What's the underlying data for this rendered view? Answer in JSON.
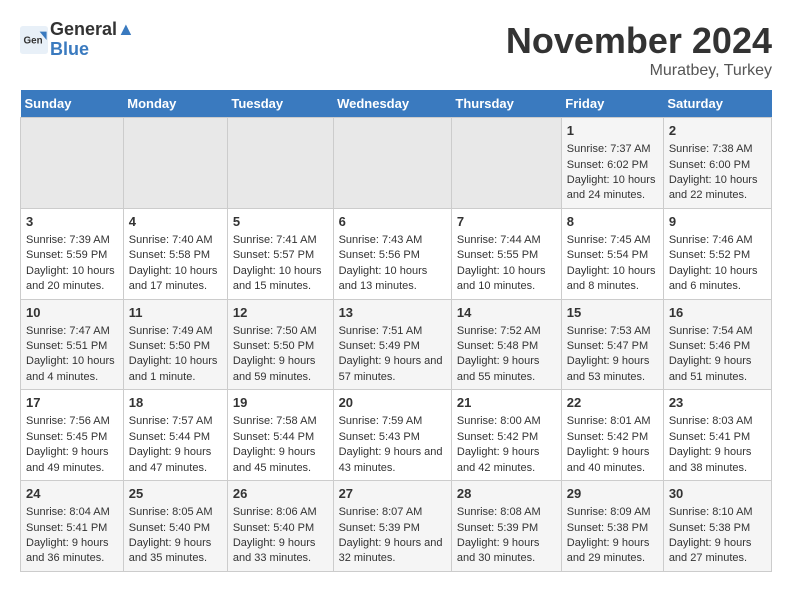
{
  "header": {
    "logo_line1": "General",
    "logo_line2": "Blue",
    "month": "November 2024",
    "location": "Muratbey, Turkey"
  },
  "days_of_week": [
    "Sunday",
    "Monday",
    "Tuesday",
    "Wednesday",
    "Thursday",
    "Friday",
    "Saturday"
  ],
  "weeks": [
    [
      {
        "day": "",
        "info": ""
      },
      {
        "day": "",
        "info": ""
      },
      {
        "day": "",
        "info": ""
      },
      {
        "day": "",
        "info": ""
      },
      {
        "day": "",
        "info": ""
      },
      {
        "day": "1",
        "info": "Sunrise: 7:37 AM\nSunset: 6:02 PM\nDaylight: 10 hours and 24 minutes."
      },
      {
        "day": "2",
        "info": "Sunrise: 7:38 AM\nSunset: 6:00 PM\nDaylight: 10 hours and 22 minutes."
      }
    ],
    [
      {
        "day": "3",
        "info": "Sunrise: 7:39 AM\nSunset: 5:59 PM\nDaylight: 10 hours and 20 minutes."
      },
      {
        "day": "4",
        "info": "Sunrise: 7:40 AM\nSunset: 5:58 PM\nDaylight: 10 hours and 17 minutes."
      },
      {
        "day": "5",
        "info": "Sunrise: 7:41 AM\nSunset: 5:57 PM\nDaylight: 10 hours and 15 minutes."
      },
      {
        "day": "6",
        "info": "Sunrise: 7:43 AM\nSunset: 5:56 PM\nDaylight: 10 hours and 13 minutes."
      },
      {
        "day": "7",
        "info": "Sunrise: 7:44 AM\nSunset: 5:55 PM\nDaylight: 10 hours and 10 minutes."
      },
      {
        "day": "8",
        "info": "Sunrise: 7:45 AM\nSunset: 5:54 PM\nDaylight: 10 hours and 8 minutes."
      },
      {
        "day": "9",
        "info": "Sunrise: 7:46 AM\nSunset: 5:52 PM\nDaylight: 10 hours and 6 minutes."
      }
    ],
    [
      {
        "day": "10",
        "info": "Sunrise: 7:47 AM\nSunset: 5:51 PM\nDaylight: 10 hours and 4 minutes."
      },
      {
        "day": "11",
        "info": "Sunrise: 7:49 AM\nSunset: 5:50 PM\nDaylight: 10 hours and 1 minute."
      },
      {
        "day": "12",
        "info": "Sunrise: 7:50 AM\nSunset: 5:50 PM\nDaylight: 9 hours and 59 minutes."
      },
      {
        "day": "13",
        "info": "Sunrise: 7:51 AM\nSunset: 5:49 PM\nDaylight: 9 hours and 57 minutes."
      },
      {
        "day": "14",
        "info": "Sunrise: 7:52 AM\nSunset: 5:48 PM\nDaylight: 9 hours and 55 minutes."
      },
      {
        "day": "15",
        "info": "Sunrise: 7:53 AM\nSunset: 5:47 PM\nDaylight: 9 hours and 53 minutes."
      },
      {
        "day": "16",
        "info": "Sunrise: 7:54 AM\nSunset: 5:46 PM\nDaylight: 9 hours and 51 minutes."
      }
    ],
    [
      {
        "day": "17",
        "info": "Sunrise: 7:56 AM\nSunset: 5:45 PM\nDaylight: 9 hours and 49 minutes."
      },
      {
        "day": "18",
        "info": "Sunrise: 7:57 AM\nSunset: 5:44 PM\nDaylight: 9 hours and 47 minutes."
      },
      {
        "day": "19",
        "info": "Sunrise: 7:58 AM\nSunset: 5:44 PM\nDaylight: 9 hours and 45 minutes."
      },
      {
        "day": "20",
        "info": "Sunrise: 7:59 AM\nSunset: 5:43 PM\nDaylight: 9 hours and 43 minutes."
      },
      {
        "day": "21",
        "info": "Sunrise: 8:00 AM\nSunset: 5:42 PM\nDaylight: 9 hours and 42 minutes."
      },
      {
        "day": "22",
        "info": "Sunrise: 8:01 AM\nSunset: 5:42 PM\nDaylight: 9 hours and 40 minutes."
      },
      {
        "day": "23",
        "info": "Sunrise: 8:03 AM\nSunset: 5:41 PM\nDaylight: 9 hours and 38 minutes."
      }
    ],
    [
      {
        "day": "24",
        "info": "Sunrise: 8:04 AM\nSunset: 5:41 PM\nDaylight: 9 hours and 36 minutes."
      },
      {
        "day": "25",
        "info": "Sunrise: 8:05 AM\nSunset: 5:40 PM\nDaylight: 9 hours and 35 minutes."
      },
      {
        "day": "26",
        "info": "Sunrise: 8:06 AM\nSunset: 5:40 PM\nDaylight: 9 hours and 33 minutes."
      },
      {
        "day": "27",
        "info": "Sunrise: 8:07 AM\nSunset: 5:39 PM\nDaylight: 9 hours and 32 minutes."
      },
      {
        "day": "28",
        "info": "Sunrise: 8:08 AM\nSunset: 5:39 PM\nDaylight: 9 hours and 30 minutes."
      },
      {
        "day": "29",
        "info": "Sunrise: 8:09 AM\nSunset: 5:38 PM\nDaylight: 9 hours and 29 minutes."
      },
      {
        "day": "30",
        "info": "Sunrise: 8:10 AM\nSunset: 5:38 PM\nDaylight: 9 hours and 27 minutes."
      }
    ]
  ]
}
